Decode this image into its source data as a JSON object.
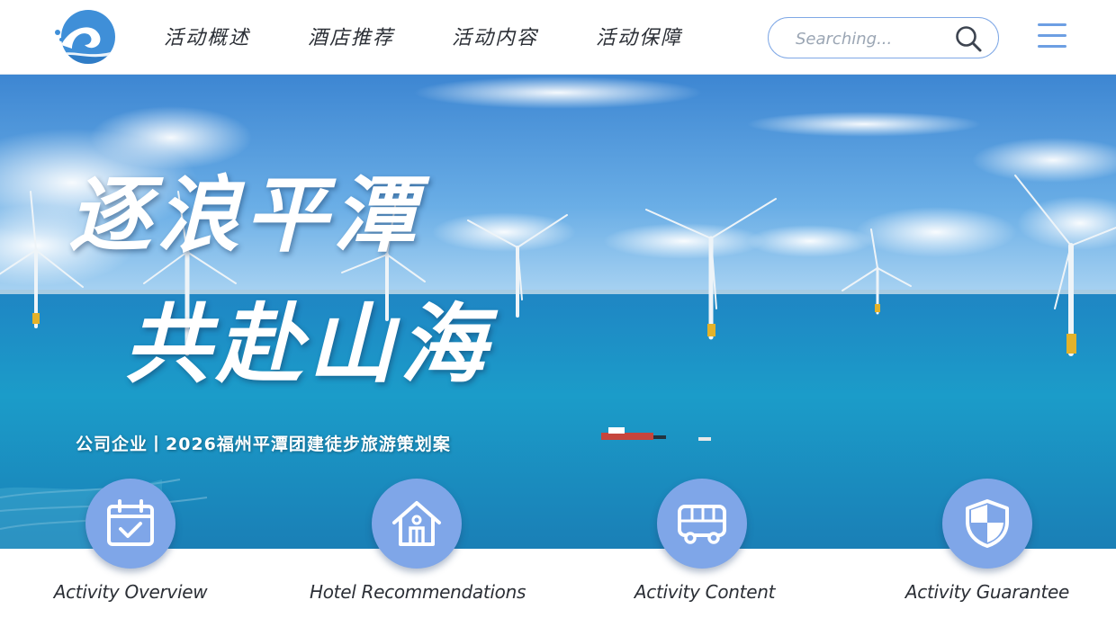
{
  "header": {
    "nav": [
      {
        "label": "活动概述"
      },
      {
        "label": "酒店推荐"
      },
      {
        "label": "活动内容"
      },
      {
        "label": "活动保障"
      }
    ],
    "search": {
      "placeholder": "Searching..."
    }
  },
  "hero": {
    "title_line1": "逐浪平潭",
    "title_line2": "共赴山海",
    "subtitle": "公司企业丨2026福州平潭团建徒步旅游策划案"
  },
  "features": [
    {
      "label": "Activity Overview",
      "icon": "calendar-check-icon"
    },
    {
      "label": "Hotel Recommendations",
      "icon": "house-icon"
    },
    {
      "label": "Activity Content",
      "icon": "bus-icon"
    },
    {
      "label": "Activity Guarantee",
      "icon": "shield-icon"
    }
  ],
  "colors": {
    "accent": "#7fa6e8",
    "nav_text": "#2b2f36",
    "sea": "#1d8fc0",
    "sky": "#4f97d8"
  }
}
